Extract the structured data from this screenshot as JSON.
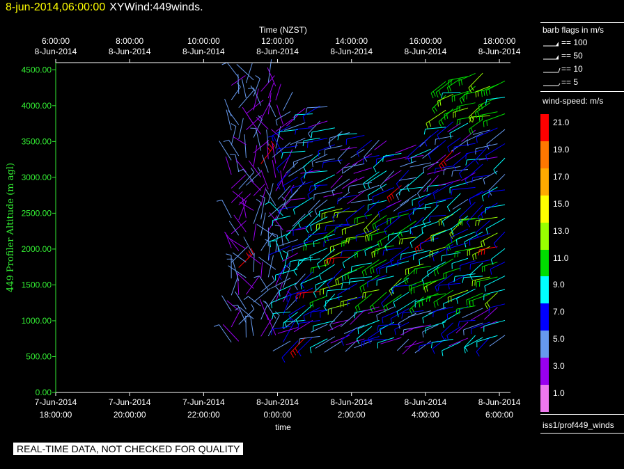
{
  "header": {
    "datetime": "8-jun-2014,06:00:00",
    "plot_name": "XYWind:449winds."
  },
  "notice": "REAL-TIME DATA, NOT CHECKED FOR QUALITY",
  "legend": {
    "barb_title": "barb flags in m/s",
    "barb_items": [
      {
        "label": "== 100",
        "kind": "flag"
      },
      {
        "label": "== 50",
        "kind": "flag"
      },
      {
        "label": "== 10",
        "kind": "full"
      },
      {
        "label": "== 5",
        "kind": "half"
      }
    ],
    "speed_title": "wind-speed: m/s",
    "source": "iss1/prof449_winds"
  },
  "colors": {
    "axis": "#ffffff",
    "altitude_axis": "#33ee33",
    "title_date": "#ffff00",
    "background": "#000000"
  },
  "chart_data": {
    "type": "wind-barb time-height plot",
    "top_axis_title": "Time (NZST)",
    "top_ticks": [
      {
        "time": "6:00:00",
        "date": "8-Jun-2014",
        "hours": 0
      },
      {
        "time": "8:00:00",
        "date": "8-Jun-2014",
        "hours": 2
      },
      {
        "time": "10:00:00",
        "date": "8-Jun-2014",
        "hours": 4
      },
      {
        "time": "12:00:00",
        "date": "8-Jun-2014",
        "hours": 6
      },
      {
        "time": "14:00:00",
        "date": "8-Jun-2014",
        "hours": 8
      },
      {
        "time": "16:00:00",
        "date": "8-Jun-2014",
        "hours": 10
      },
      {
        "time": "18:00:00",
        "date": "8-Jun-2014",
        "hours": 12
      }
    ],
    "bottom_axis_title": "time",
    "bottom_ticks": [
      {
        "date": "7-Jun-2014",
        "time": "18:00:00",
        "hours": 0
      },
      {
        "date": "7-Jun-2014",
        "time": "20:00:00",
        "hours": 2
      },
      {
        "date": "7-Jun-2014",
        "time": "22:00:00",
        "hours": 4
      },
      {
        "date": "8-Jun-2014",
        "time": "0:00:00",
        "hours": 6
      },
      {
        "date": "8-Jun-2014",
        "time": "2:00:00",
        "hours": 8
      },
      {
        "date": "8-Jun-2014",
        "time": "4:00:00",
        "hours": 10
      },
      {
        "date": "8-Jun-2014",
        "time": "6:00:00",
        "hours": 12
      }
    ],
    "time_range_hours": [
      0,
      12.3
    ],
    "y_label": "449 Profiler Altitude (m agl)",
    "y_ticks": [
      "0.00",
      "500.00",
      "1000.00",
      "1500.00",
      "2000.00",
      "2500.00",
      "3000.00",
      "3500.00",
      "4000.00",
      "4500.00"
    ],
    "ylim": [
      0,
      4600
    ],
    "speed_scale": [
      {
        "label": "21.0",
        "color": "#ff0000"
      },
      {
        "label": "19.0",
        "color": "#ff7700"
      },
      {
        "label": "17.0",
        "color": "#ffaa00"
      },
      {
        "label": "15.0",
        "color": "#ffff00"
      },
      {
        "label": "13.0",
        "color": "#99ff00"
      },
      {
        "label": "11.0",
        "color": "#00dd00"
      },
      {
        "label": "9.0",
        "color": "#00ffff"
      },
      {
        "label": "7.0",
        "color": "#0000ff"
      },
      {
        "label": "5.0",
        "color": "#6699ee"
      },
      {
        "label": "3.0",
        "color": "#9900ee"
      },
      {
        "label": "1.0",
        "color": "#ee77ee"
      }
    ],
    "barb_field": {
      "time_start_hours": 4.75,
      "time_end_hours": 12.2,
      "time_step_hours": 0.2,
      "altitude_start_m": 700,
      "altitude_step_m": 200,
      "note": "barb field approximated; individual barbs not legible"
    }
  }
}
